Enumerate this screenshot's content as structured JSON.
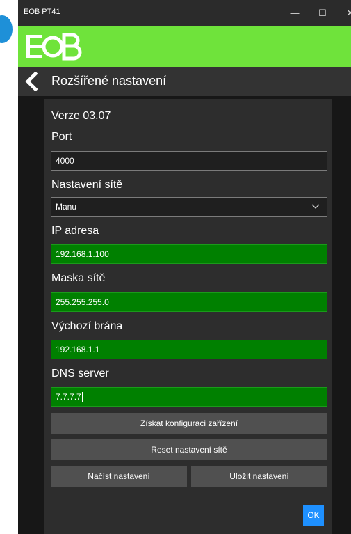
{
  "window": {
    "title": "EOB PT41",
    "minimize": "—",
    "maximize": "☐",
    "close": "✕"
  },
  "header": {
    "title": "Rozšířené nastavení"
  },
  "version": "Verze 03.07",
  "port": {
    "label": "Port",
    "value": "4000"
  },
  "network": {
    "label": "Nastavení sítě",
    "selected": "Manu"
  },
  "ip": {
    "label": "IP adresa",
    "value": "192.168.1.100"
  },
  "mask": {
    "label": "Maska sítě",
    "value": "255.255.255.0"
  },
  "gateway": {
    "label": "Výchozí brána",
    "value": "192.168.1.1"
  },
  "dns": {
    "label": "DNS server",
    "value": "7.7.7.7"
  },
  "buttons": {
    "get_config": "Získat konfiguraci zařízení",
    "reset": "Reset nastavení sítě",
    "load": "Načíst nastavení",
    "save": "Uložit nastavení",
    "ok": "OK"
  },
  "colors": {
    "brand": "#6fe33b",
    "field_green": "#008000",
    "ok": "#1e90ff"
  }
}
